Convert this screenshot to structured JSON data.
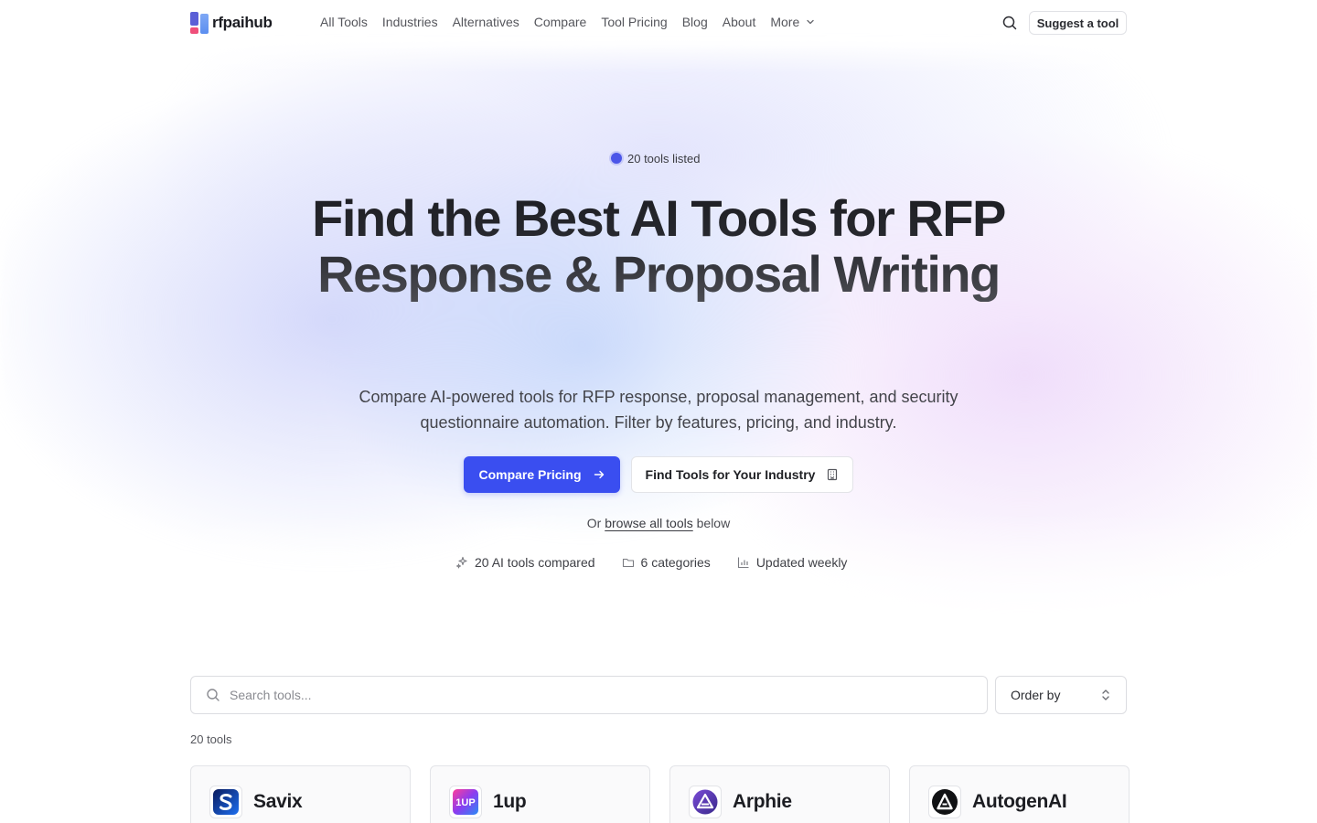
{
  "brand": {
    "name": "rfpaihub"
  },
  "nav": {
    "links": [
      "All Tools",
      "Industries",
      "Alternatives",
      "Compare",
      "Tool Pricing",
      "Blog",
      "About"
    ],
    "more_label": "More",
    "suggest_label": "Suggest a tool"
  },
  "hero": {
    "badge": "20 tools listed",
    "headline": "Find the Best AI Tools for RFP Response & Proposal Writing",
    "subhead": "Compare AI-powered tools for RFP response, proposal management, and security questionnaire automation. Filter by features, pricing, and industry.",
    "primary_cta": "Compare Pricing",
    "secondary_cta": "Find Tools for Your Industry",
    "browse_prefix": "Or",
    "browse_link": "browse all tools",
    "browse_suffix": "below",
    "stats": [
      {
        "icon": "sparkles-icon",
        "label": "20 AI tools compared"
      },
      {
        "icon": "folder-icon",
        "label": "6 categories"
      },
      {
        "icon": "bar-chart-icon",
        "label": "Updated weekly"
      }
    ]
  },
  "tools": {
    "search_placeholder": "Search tools...",
    "order_label": "Order by",
    "count_label": "20 tools",
    "items": [
      {
        "name": "Savix",
        "logo": "savix-logo"
      },
      {
        "name": "1up",
        "logo": "1up-logo"
      },
      {
        "name": "Arphie",
        "logo": "arphie-logo"
      },
      {
        "name": "AutogenAI",
        "logo": "autogenai-logo"
      }
    ]
  },
  "colors": {
    "accent": "#3a4ef0",
    "text": "#1f2024",
    "muted": "#55565c"
  }
}
